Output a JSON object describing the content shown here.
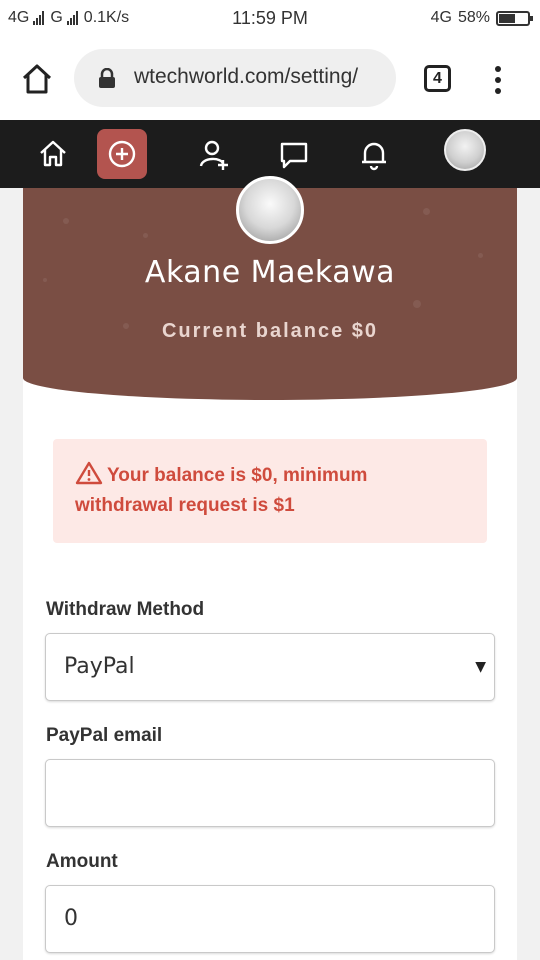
{
  "status_bar": {
    "network_left": "4G",
    "network_left2": "G",
    "speed": "0.1K/s",
    "time": "11:59 PM",
    "network_right": "4G",
    "battery": "58%",
    "battery_level": 0.58
  },
  "browser": {
    "url": "wtechworld.com/setting/",
    "tab_count": "4"
  },
  "site_nav": {
    "items": [
      "home-icon",
      "add-post-icon",
      "add-friend-icon",
      "messages-icon",
      "notifications-icon",
      "profile-avatar"
    ],
    "accent": "#b3544f"
  },
  "profile": {
    "name": "Akane Maekawa",
    "balance_text": "Current  balance  $0",
    "hero_color": "#7a4e44"
  },
  "alert": {
    "message": "Your balance is $0, minimum withdrawal request is $1",
    "icon": "warning-icon",
    "color": "#cf4b3d"
  },
  "form": {
    "method_label": "Withdraw Method",
    "method_value": "PayPal",
    "email_label": "PayPal email",
    "email_value": "",
    "amount_label": "Amount",
    "amount_value": "0"
  }
}
